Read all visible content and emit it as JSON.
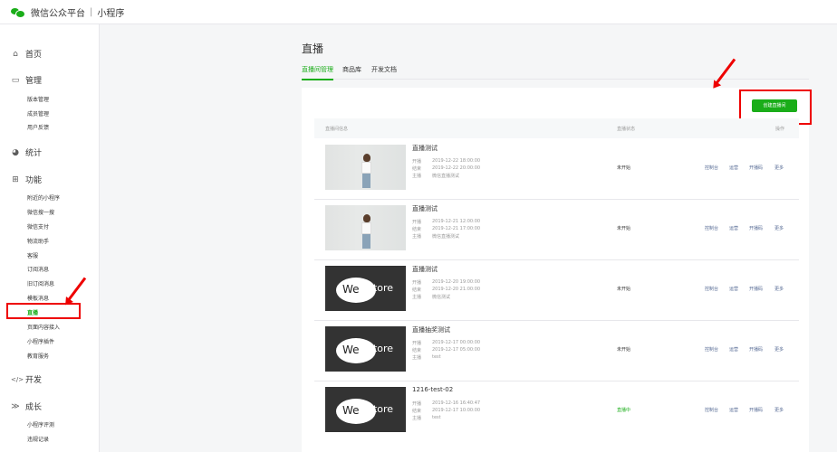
{
  "topbar": {
    "brand": "微信公众平台",
    "separator": "|",
    "product": "小程序"
  },
  "sidebar": {
    "sections": [
      {
        "label": "首页",
        "icon": "home-icon",
        "glyph": "⌂"
      },
      {
        "label": "管理",
        "icon": "inbox-icon",
        "glyph": "▭"
      },
      {
        "label": "统计",
        "icon": "pie-chart-icon",
        "glyph": "◕"
      },
      {
        "label": "功能",
        "icon": "grid-icon",
        "glyph": "⊞"
      },
      {
        "label": "开发",
        "icon": "code-icon",
        "glyph": "</>"
      },
      {
        "label": "成长",
        "icon": "chevron-double-icon",
        "glyph": "≫"
      }
    ],
    "manage_items": [
      "版本管理",
      "成员管理",
      "用户反馈"
    ],
    "feature_items": [
      "附近的小程序",
      "微信搜一搜",
      "微信支付",
      "物流助手",
      "客服",
      "订阅消息",
      "旧订阅消息",
      "模板消息",
      "直播",
      "页面内容接入",
      "小程序插件",
      "教育服务"
    ],
    "growth_items": [
      "小程序评测",
      "违规记录"
    ]
  },
  "main": {
    "title": "直播",
    "tabs": [
      "直播间管理",
      "商品库",
      "开发文档"
    ],
    "create_button": "创建直播间",
    "columns": [
      "直播间信息",
      "直播状态",
      "操作"
    ],
    "labels": {
      "start": "开播",
      "end": "结束",
      "anchor": "主播"
    },
    "ops": [
      "控制台",
      "运营",
      "开播码",
      "更多"
    ],
    "rooms": [
      {
        "name": "直播测试",
        "start": "2019-12-22 18:00:00",
        "end": "2019-12-22 20:00:00",
        "anchor": "微信直播测试",
        "status": "未开始",
        "thumb": "photo"
      },
      {
        "name": "直播测试",
        "start": "2019-12-21 12:00:00",
        "end": "2019-12-21 17:00:00",
        "anchor": "微信直播测试",
        "status": "未开始",
        "thumb": "photo"
      },
      {
        "name": "直播测试",
        "start": "2019-12-20 19:00:00",
        "end": "2019-12-20 21:00:00",
        "anchor": "微信测试",
        "status": "未开始",
        "thumb": "westore"
      },
      {
        "name": "直播抽奖测试",
        "start": "2019-12-17 00:00:00",
        "end": "2019-12-17 05:00:00",
        "anchor": "test",
        "status": "未开始",
        "thumb": "westore"
      },
      {
        "name": "1216-test-02",
        "start": "2019-12-16 16:40:47",
        "end": "2019-12-17 10:00:00",
        "anchor": "test",
        "status": "直播中",
        "thumb": "westore"
      }
    ],
    "thumb_text": {
      "we": "We",
      "store": "Store"
    }
  },
  "colors": {
    "accent": "#1aad19",
    "link": "#576b95",
    "annotation": "#e00000"
  }
}
